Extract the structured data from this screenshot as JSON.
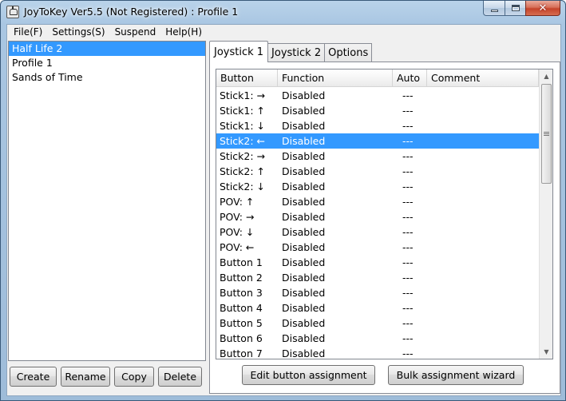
{
  "window": {
    "title": "JoyToKey Ver5.5 (Not Registered) : Profile 1",
    "close_symbol": "✕"
  },
  "menu": [
    "File(F)",
    "Settings(S)",
    "Suspend",
    "Help(H)"
  ],
  "profiles": {
    "items": [
      "Half Life 2",
      "Profile 1",
      "Sands of Time"
    ],
    "selected": "Half Life 2"
  },
  "profile_buttons": {
    "create": "Create",
    "rename": "Rename",
    "copy": "Copy",
    "delete": "Delete"
  },
  "tabs": [
    "Joystick 1",
    "Joystick 2",
    "Options"
  ],
  "active_tab": "Joystick 1",
  "table": {
    "columns": [
      "Button",
      "Function",
      "Auto",
      "Comment"
    ],
    "rows": [
      {
        "button": "Stick1: →",
        "function": "Disabled",
        "auto": "---",
        "comment": ""
      },
      {
        "button": "Stick1: ↑",
        "function": "Disabled",
        "auto": "---",
        "comment": ""
      },
      {
        "button": "Stick1: ↓",
        "function": "Disabled",
        "auto": "---",
        "comment": ""
      },
      {
        "button": "Stick2: ←",
        "function": "Disabled",
        "auto": "---",
        "comment": "",
        "selected": true
      },
      {
        "button": "Stick2: →",
        "function": "Disabled",
        "auto": "---",
        "comment": ""
      },
      {
        "button": "Stick2: ↑",
        "function": "Disabled",
        "auto": "---",
        "comment": ""
      },
      {
        "button": "Stick2: ↓",
        "function": "Disabled",
        "auto": "---",
        "comment": ""
      },
      {
        "button": "POV: ↑",
        "function": "Disabled",
        "auto": "---",
        "comment": ""
      },
      {
        "button": "POV: →",
        "function": "Disabled",
        "auto": "---",
        "comment": ""
      },
      {
        "button": "POV: ↓",
        "function": "Disabled",
        "auto": "---",
        "comment": ""
      },
      {
        "button": "POV: ←",
        "function": "Disabled",
        "auto": "---",
        "comment": ""
      },
      {
        "button": "Button 1",
        "function": "Disabled",
        "auto": "---",
        "comment": ""
      },
      {
        "button": "Button 2",
        "function": "Disabled",
        "auto": "---",
        "comment": ""
      },
      {
        "button": "Button 3",
        "function": "Disabled",
        "auto": "---",
        "comment": ""
      },
      {
        "button": "Button 4",
        "function": "Disabled",
        "auto": "---",
        "comment": ""
      },
      {
        "button": "Button 5",
        "function": "Disabled",
        "auto": "---",
        "comment": ""
      },
      {
        "button": "Button 6",
        "function": "Disabled",
        "auto": "---",
        "comment": ""
      },
      {
        "button": "Button 7",
        "function": "Disabled",
        "auto": "---",
        "comment": ""
      }
    ]
  },
  "scrollbar": {
    "up_symbol": "▲",
    "down_symbol": "▼"
  },
  "assignment_buttons": {
    "edit": "Edit button assignment",
    "bulk": "Bulk assignment wizard"
  },
  "colors": {
    "selection": "#3399ff",
    "close_button": "#c5432a",
    "title_bar": "#b9d3ea"
  }
}
